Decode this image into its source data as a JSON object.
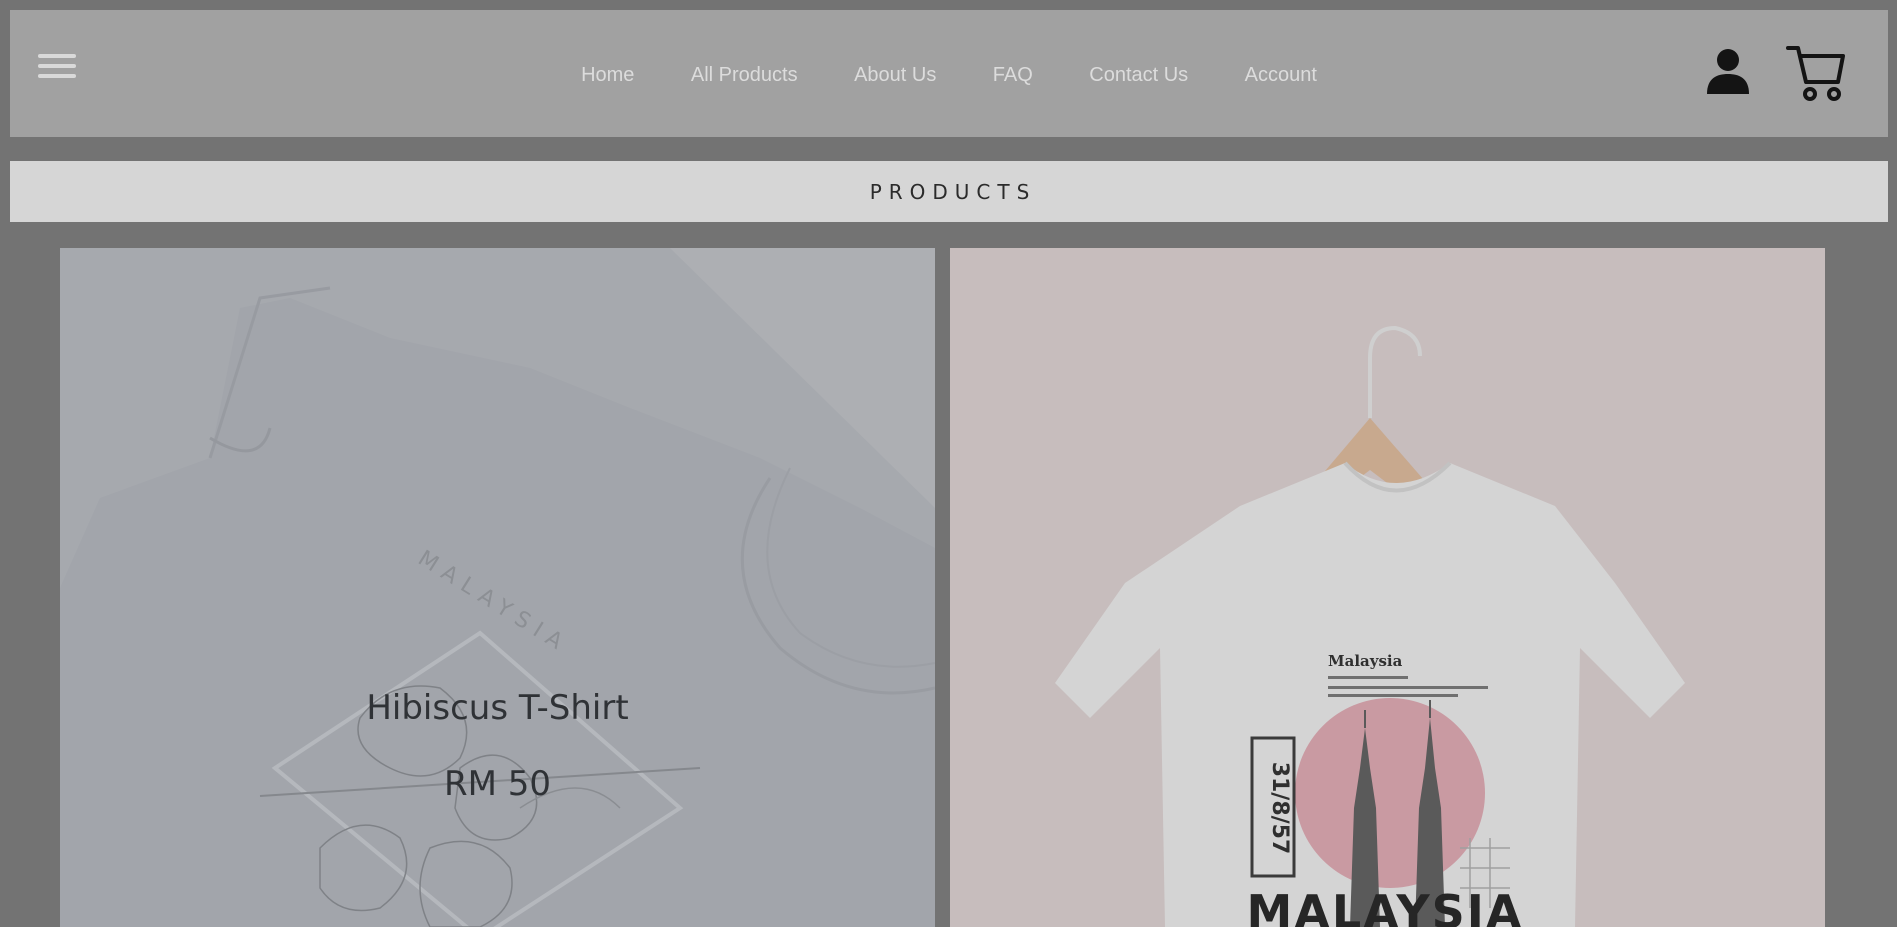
{
  "nav": {
    "menu_icon": "hamburger-menu-icon",
    "links": [
      {
        "label": "Home"
      },
      {
        "label": "All Products"
      },
      {
        "label": "About Us"
      },
      {
        "label": "FAQ"
      },
      {
        "label": "Contact Us"
      },
      {
        "label": "Account"
      }
    ],
    "account_icon": "user-icon",
    "cart_icon": "shopping-cart-icon"
  },
  "section": {
    "title": "PRODUCTS"
  },
  "products": [
    {
      "name": "Hibiscus T-Shirt",
      "price": "RM 50",
      "image_print": "MALAYSIA"
    },
    {
      "image_print_heading": "Malaysia",
      "image_print_date": "31/8/57",
      "image_print_word": "MALAYSIA"
    }
  ],
  "colors": {
    "page_background": "#737373",
    "header_background": "#a1a1a1",
    "products_bar_background": "#d6d6d6",
    "nav_text": "#dcdcdc"
  }
}
